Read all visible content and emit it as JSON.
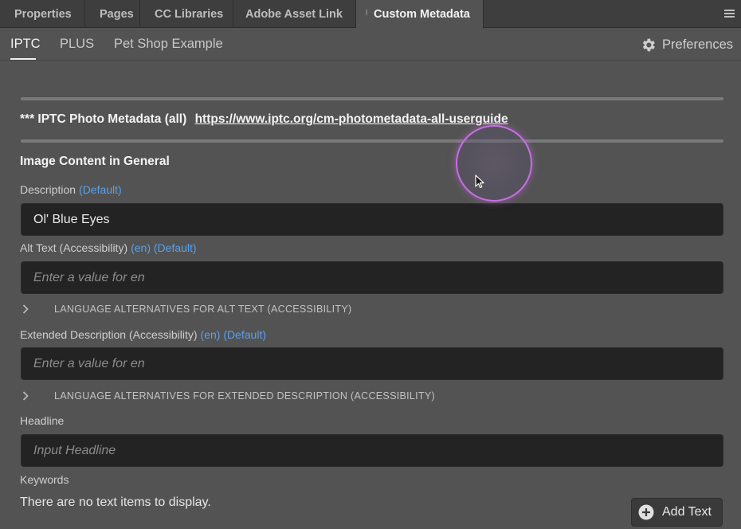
{
  "panel_tabs": [
    {
      "label": "Properties"
    },
    {
      "label": "Pages"
    },
    {
      "label": "CC Libraries"
    },
    {
      "label": "Adobe Asset Link"
    },
    {
      "label": "Custom Metadata",
      "active": true
    }
  ],
  "sub_tabs": [
    {
      "label": "IPTC",
      "active": true
    },
    {
      "label": "PLUS"
    },
    {
      "label": "Pet Shop Example"
    }
  ],
  "preferences_label": "Preferences",
  "iptc_header": {
    "prefix": "*** IPTC Photo Metadata (all)",
    "link": "https://www.iptc.org/cm-photometadata-all-userguide"
  },
  "section_title": "Image Content in General",
  "fields": {
    "description": {
      "label": "Description",
      "tag": "(Default)",
      "value": "Ol' Blue Eyes"
    },
    "alt_text": {
      "label": "Alt Text (Accessibility)",
      "tag": "(en) (Default)",
      "placeholder": "Enter a value for en",
      "lang_alt_label": "LANGUAGE ALTERNATIVES FOR ALT TEXT (ACCESSIBILITY)"
    },
    "extended_description": {
      "label": "Extended Description (Accessibility)",
      "tag": "(en) (Default)",
      "placeholder": "Enter a value for en",
      "lang_alt_label": "LANGUAGE ALTERNATIVES FOR EXTENDED DESCRIPTION (ACCESSIBILITY)"
    },
    "headline": {
      "label": "Headline",
      "placeholder": "Input Headline"
    },
    "keywords": {
      "label": "Keywords",
      "empty_message": "There are no text items to display.",
      "add_button_label": "Add Text"
    }
  },
  "icons": {
    "panel_menu": "hamburger-menu-icon",
    "preferences": "gear-icon",
    "expand": "chevron-right-icon",
    "add": "plus-circle-icon",
    "cursor": "mouse-pointer-icon"
  },
  "colors": {
    "panel_bg": "#535353",
    "tab_strip_bg": "#3e3e3e",
    "input_bg": "#232323",
    "accent_link": "#5aa0ea",
    "cursor_ring": "#c86ee6"
  }
}
